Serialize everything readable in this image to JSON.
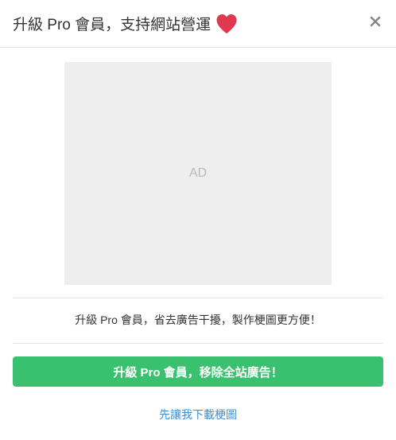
{
  "modal": {
    "title": "升級 Pro 會員，支持網站營運",
    "title_icon": "heart-icon",
    "close_icon": "close-icon",
    "ad_placeholder": "AD",
    "promo_text": "升級 Pro 會員，省去廣告干擾，製作梗圖更方便！",
    "upgrade_button_label": "升級 Pro 會員，移除全站廣告！",
    "skip_link_label": "先讓我下載梗圖"
  },
  "colors": {
    "primary_green": "#3ac170",
    "link_blue": "#3d8fd6",
    "heart_red": "#e0384f",
    "ad_background": "#eeeeee"
  }
}
